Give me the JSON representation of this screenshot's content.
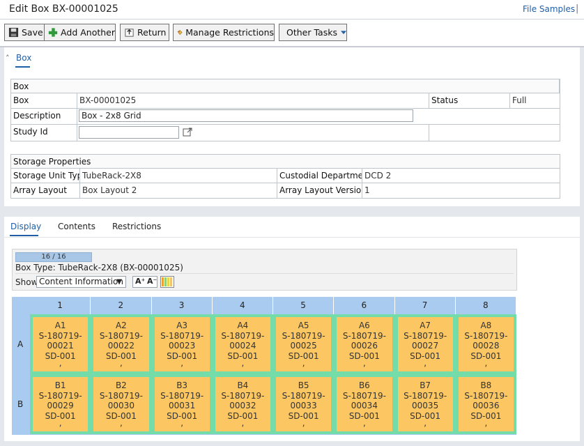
{
  "header": {
    "title": "Edit Box BX-00001025",
    "link": "File Samples",
    "separator": "|"
  },
  "toolbar": {
    "save": "Save",
    "add_another": "Add Another",
    "return": "Return",
    "manage_restrictions": "Manage Restrictions",
    "other_tasks": "Other Tasks"
  },
  "box_section": {
    "tab": "Box",
    "table_title": "Box",
    "box_label": "Box",
    "box_value": "BX-00001025",
    "status_label": "Status",
    "status_value": "Full",
    "description_label": "Description",
    "description_value": "Box - 2x8 Grid",
    "study_label": "Study Id",
    "study_value": ""
  },
  "storage": {
    "title": "Storage Properties",
    "unit_type_label": "Storage Unit Type",
    "unit_type_value": "TubeRack-2X8",
    "custodial_label": "Custodial Department",
    "custodial_value": "DCD 2",
    "array_layout_label": "Array Layout",
    "array_layout_value": "Box Layout 2",
    "array_version_label": "Array Layout Version",
    "array_version_value": "1"
  },
  "lower_tabs": {
    "display": "Display",
    "contents": "Contents",
    "restrictions": "Restrictions"
  },
  "display_panel": {
    "progress_text": "16 / 16",
    "progress_fraction": 1.0,
    "box_type": "Box Type: TubeRack-2X8 (BX-00001025)",
    "show_label": "Show",
    "show_value": "Content Information",
    "font_up": "A⁺",
    "font_down": "A⁻"
  },
  "grid": {
    "columns": [
      "1",
      "2",
      "3",
      "4",
      "5",
      "6",
      "7",
      "8"
    ],
    "rows": [
      "A",
      "B"
    ],
    "slots": [
      [
        {
          "pos": "A1",
          "sample": "S-180719-00021",
          "study": "SD-001",
          "extra": ","
        },
        {
          "pos": "A2",
          "sample": "S-180719-00022",
          "study": "SD-001",
          "extra": ","
        },
        {
          "pos": "A3",
          "sample": "S-180719-00023",
          "study": "SD-001",
          "extra": ","
        },
        {
          "pos": "A4",
          "sample": "S-180719-00024",
          "study": "SD-001",
          "extra": ","
        },
        {
          "pos": "A5",
          "sample": "S-180719-00025",
          "study": "SD-001",
          "extra": ","
        },
        {
          "pos": "A6",
          "sample": "S-180719-00026",
          "study": "SD-001",
          "extra": ","
        },
        {
          "pos": "A7",
          "sample": "S-180719-00027",
          "study": "SD-001",
          "extra": ","
        },
        {
          "pos": "A8",
          "sample": "S-180719-00028",
          "study": "SD-001",
          "extra": ","
        }
      ],
      [
        {
          "pos": "B1",
          "sample": "S-180719-00029",
          "study": "SD-001",
          "extra": ","
        },
        {
          "pos": "B2",
          "sample": "S-180719-00030",
          "study": "SD-001",
          "extra": ","
        },
        {
          "pos": "B3",
          "sample": "S-180719-00031",
          "study": "SD-001",
          "extra": ","
        },
        {
          "pos": "B4",
          "sample": "S-180719-00032",
          "study": "SD-001",
          "extra": ","
        },
        {
          "pos": "B5",
          "sample": "S-180719-00033",
          "study": "SD-001",
          "extra": ","
        },
        {
          "pos": "B6",
          "sample": "S-180719-00034",
          "study": "SD-001",
          "extra": ","
        },
        {
          "pos": "B7",
          "sample": "S-180719-00035",
          "study": "SD-001",
          "extra": ","
        },
        {
          "pos": "B8",
          "sample": "S-180719-00036",
          "study": "SD-001",
          "extra": ","
        }
      ]
    ]
  },
  "colors": {
    "accent": "#1f5fa8",
    "slot_fill": "#fcc762",
    "slot_border": "#74dca8",
    "grid_header": "#a9cbef"
  }
}
